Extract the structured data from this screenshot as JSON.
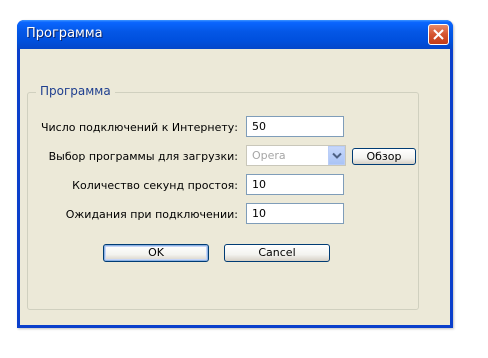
{
  "window": {
    "title": "Программа"
  },
  "group": {
    "legend": "Программа"
  },
  "fields": {
    "connections_label": "Число подключений к Интернету:",
    "connections_value": "50",
    "program_label": "Выбор программы для загрузки:",
    "program_value": "Opera",
    "browse_label": "Обзор",
    "idle_label": "Количество секунд простоя:",
    "idle_value": "10",
    "wait_label": "Ожидания при подключении:",
    "wait_value": "10"
  },
  "buttons": {
    "ok": "OK",
    "cancel": "Cancel"
  },
  "icons": {
    "close": "close-icon",
    "dropdown": "chevron-down-icon"
  },
  "colors": {
    "titlebar": "#0054e3",
    "dialog_bg": "#ece9d8",
    "close_button": "#d5542f",
    "group_legend": "#1f3f8f"
  }
}
